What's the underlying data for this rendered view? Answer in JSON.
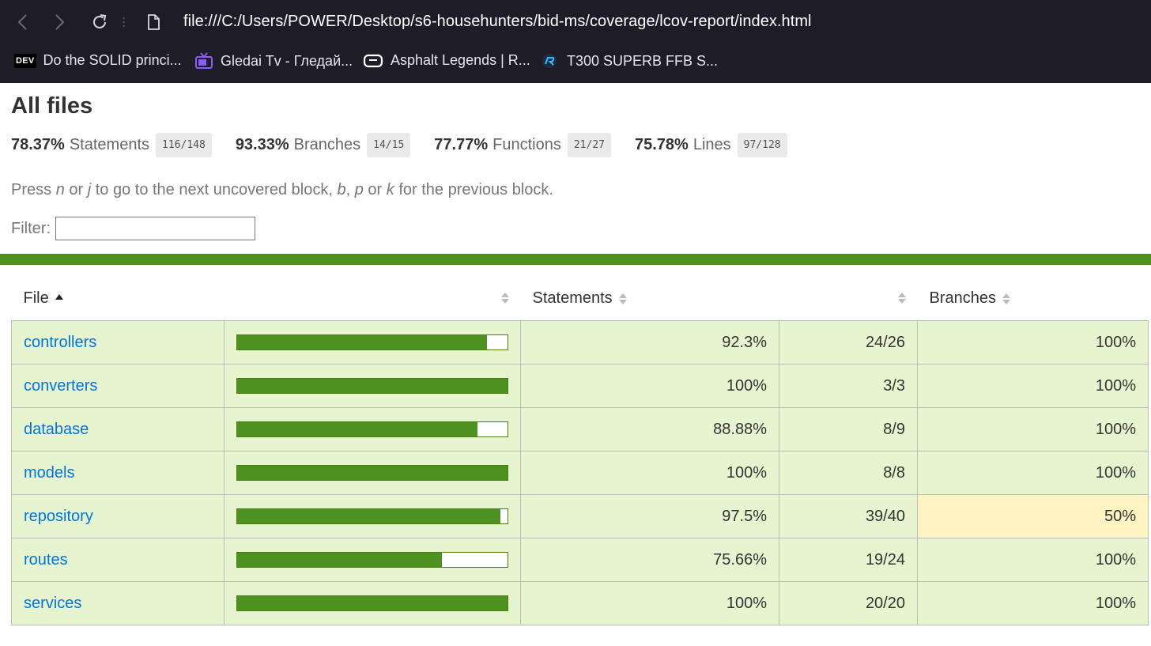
{
  "browser": {
    "url": "file:///C:/Users/POWER/Desktop/s6-househunters/bid-ms/coverage/lcov-report/index.html",
    "bookmarks": [
      {
        "icon": "dev-icon",
        "label": "Do the SOLID princi..."
      },
      {
        "icon": "tv-icon",
        "label": "Gledai Tv - Гледай..."
      },
      {
        "icon": "gameloft-icon",
        "label": "Asphalt Legends | R..."
      },
      {
        "icon": "racing-icon",
        "label": "T300 SUPERB FFB S..."
      }
    ],
    "dev_badge": "DEV"
  },
  "report": {
    "title": "All files",
    "summary": [
      {
        "pct": "78.37%",
        "label": "Statements",
        "frac": "116/148"
      },
      {
        "pct": "93.33%",
        "label": "Branches",
        "frac": "14/15"
      },
      {
        "pct": "77.77%",
        "label": "Functions",
        "frac": "21/27"
      },
      {
        "pct": "75.78%",
        "label": "Lines",
        "frac": "97/128"
      }
    ],
    "hint": {
      "t1": "Press ",
      "k1": "n",
      "t2": " or ",
      "k2": "j",
      "t3": " to go to the next uncovered block, ",
      "k3": "b",
      "t4": ", ",
      "k4": "p",
      "t5": " or ",
      "k5": "k",
      "t6": " for the previous block."
    },
    "filter_label": "Filter:",
    "filter_value": "",
    "colors": {
      "high": "#e6f5d0",
      "medium": "#fff4c2",
      "bar": "#4d9221",
      "status_bar": "#4d9221"
    }
  },
  "table": {
    "headers": {
      "file": "File",
      "statements": "Statements",
      "branches": "Branches"
    },
    "rows": [
      {
        "file": "controllers",
        "coverage": 0.923,
        "stmt_pct": "92.3%",
        "stmt_frac": "24/26",
        "branch_pct": "100%",
        "branch_level": "high"
      },
      {
        "file": "converters",
        "coverage": 1.0,
        "stmt_pct": "100%",
        "stmt_frac": "3/3",
        "branch_pct": "100%",
        "branch_level": "high"
      },
      {
        "file": "database",
        "coverage": 0.8888,
        "stmt_pct": "88.88%",
        "stmt_frac": "8/9",
        "branch_pct": "100%",
        "branch_level": "high"
      },
      {
        "file": "models",
        "coverage": 1.0,
        "stmt_pct": "100%",
        "stmt_frac": "8/8",
        "branch_pct": "100%",
        "branch_level": "high"
      },
      {
        "file": "repository",
        "coverage": 0.975,
        "stmt_pct": "97.5%",
        "stmt_frac": "39/40",
        "branch_pct": "50%",
        "branch_level": "medium"
      },
      {
        "file": "routes",
        "coverage": 0.7566,
        "stmt_pct": "75.66%",
        "stmt_frac": "19/24",
        "branch_pct": "100%",
        "branch_level": "high"
      },
      {
        "file": "services",
        "coverage": 1.0,
        "stmt_pct": "100%",
        "stmt_frac": "20/20",
        "branch_pct": "100%",
        "branch_level": "high"
      }
    ]
  }
}
